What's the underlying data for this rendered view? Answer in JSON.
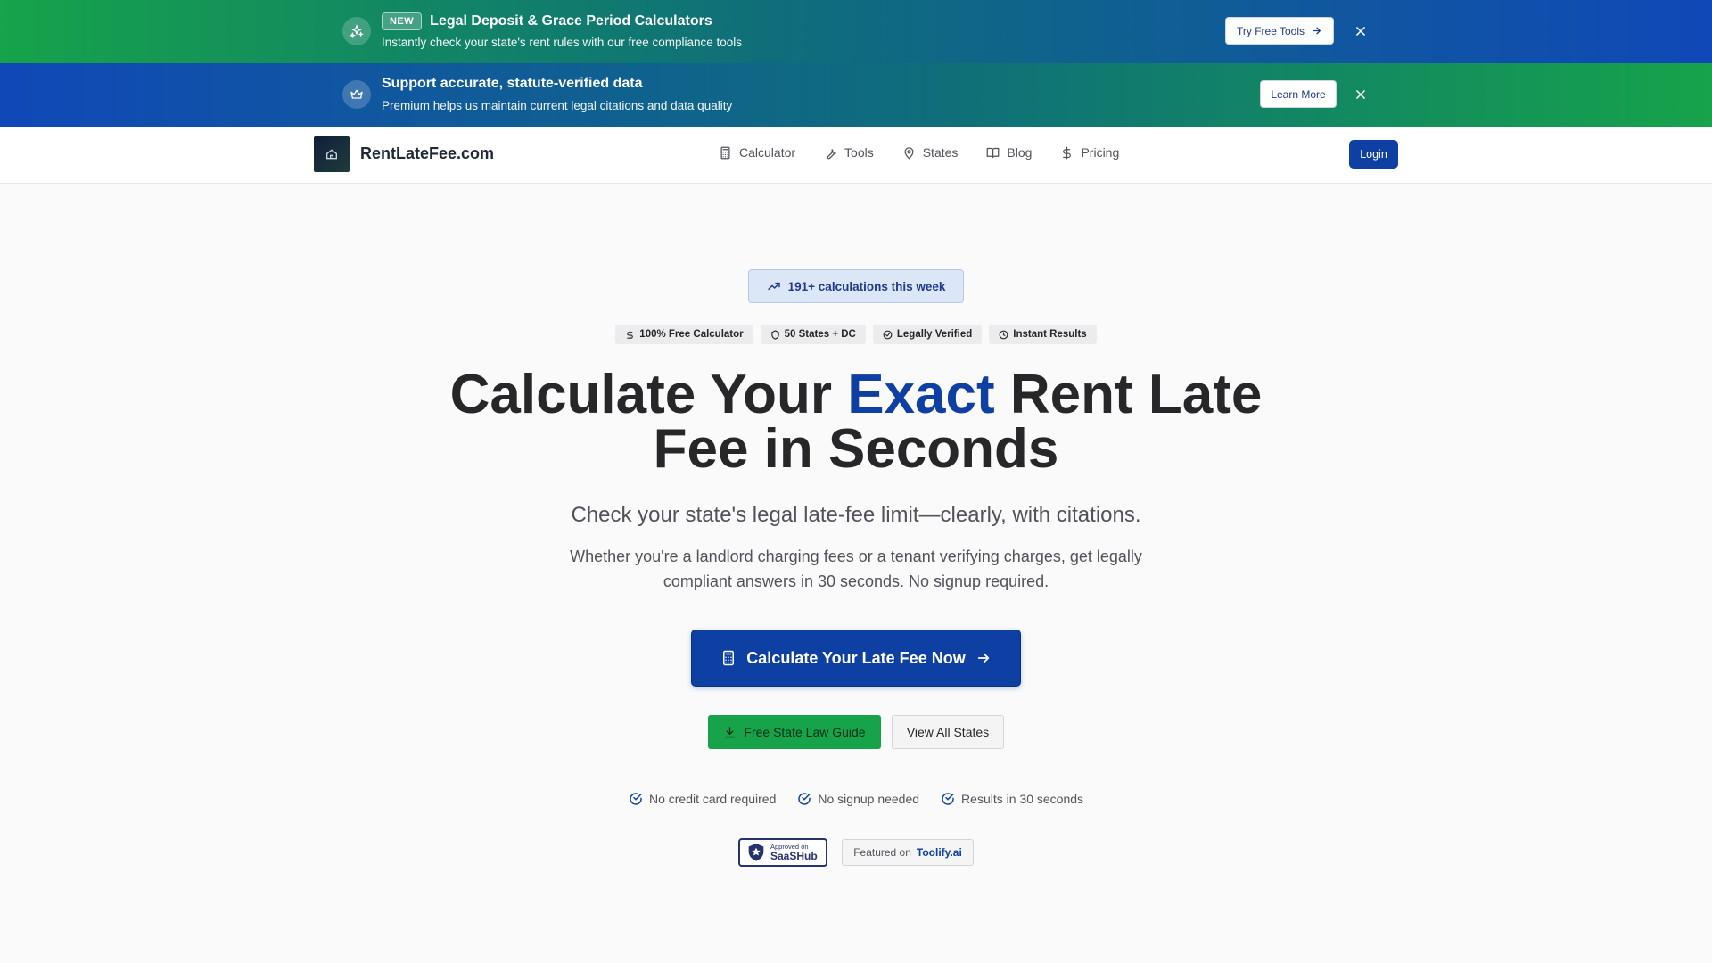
{
  "banners": [
    {
      "badge": "NEW",
      "title": "Legal Deposit & Grace Period Calculators",
      "subtitle": "Instantly check your state's rent rules with our free compliance tools",
      "button": "Try Free Tools",
      "icon": "sparkles-icon"
    },
    {
      "title": "Support accurate, statute-verified data",
      "subtitle": "Premium helps us maintain current legal citations and data quality",
      "button": "Learn More",
      "icon": "crown-icon"
    }
  ],
  "nav": {
    "brand": "RentLateFee.com",
    "items": [
      {
        "label": "Calculator",
        "icon": "calculator-icon"
      },
      {
        "label": "Tools",
        "icon": "wrench-icon"
      },
      {
        "label": "States",
        "icon": "map-pin-icon"
      },
      {
        "label": "Blog",
        "icon": "book-icon"
      },
      {
        "label": "Pricing",
        "icon": "dollar-icon"
      }
    ],
    "login": "Login"
  },
  "hero": {
    "stat": "191+ calculations this week",
    "features": [
      "100% Free Calculator",
      "50 States + DC",
      "Legally Verified",
      "Instant Results"
    ],
    "title_pre": "Calculate Your ",
    "title_accent": "Exact",
    "title_post": " Rent Late Fee in Seconds",
    "tagline": "Check your state's legal late-fee limit—clearly, with citations.",
    "description": "Whether you're a landlord charging fees or a tenant verifying charges, get legally compliant answers in 30 seconds. No signup required.",
    "cta": "Calculate Your Late Fee Now",
    "secondary_green": "Free State Law Guide",
    "secondary_outline": "View All States",
    "checks": [
      "No credit card required",
      "No signup needed",
      "Results in 30 seconds"
    ]
  },
  "badges": {
    "saashub_small": "Approved on",
    "saashub_big": "SaaSHub",
    "toolify_pre": "Featured on",
    "toolify_name": "Toolify.ai"
  },
  "colors": {
    "primary": "#0e3fa3",
    "green": "#16a34a",
    "text": "#27272a"
  }
}
